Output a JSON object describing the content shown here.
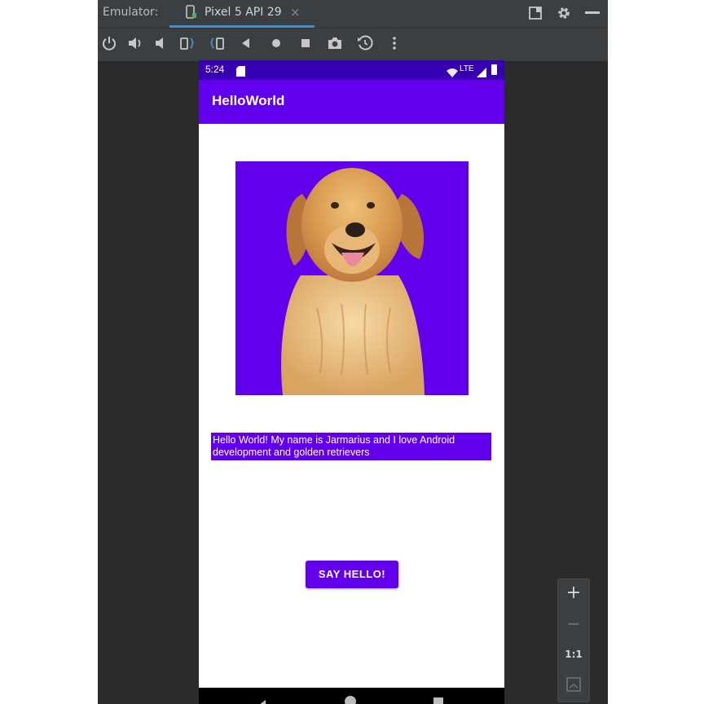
{
  "emulator": {
    "label": "Emulator:",
    "tab_title": "Pixel 5 API 29",
    "tab_close": "×",
    "toolbar_icons": [
      "power-icon",
      "volume-up-icon",
      "volume-down-icon",
      "rotate-left-icon",
      "rotate-right-icon",
      "back-icon",
      "home-icon",
      "overview-icon",
      "camera-icon",
      "snapshot-icon",
      "more-icon"
    ],
    "zoom": {
      "zoom_in": "+",
      "zoom_out": "−",
      "one_to_one": "1:1"
    }
  },
  "device": {
    "status": {
      "time": "5:24",
      "network": "LTE"
    },
    "app": {
      "title": "HelloWorld",
      "message": "Hello World! My name is Jarmarius and I love Android development and golden retrievers",
      "button_label": "SAY HELLO!"
    }
  },
  "colors": {
    "primary": "#6200ee",
    "primary_dark": "#3700b3",
    "ide_background": "#2b2b2b",
    "ide_toolbar": "#3c3f41"
  }
}
